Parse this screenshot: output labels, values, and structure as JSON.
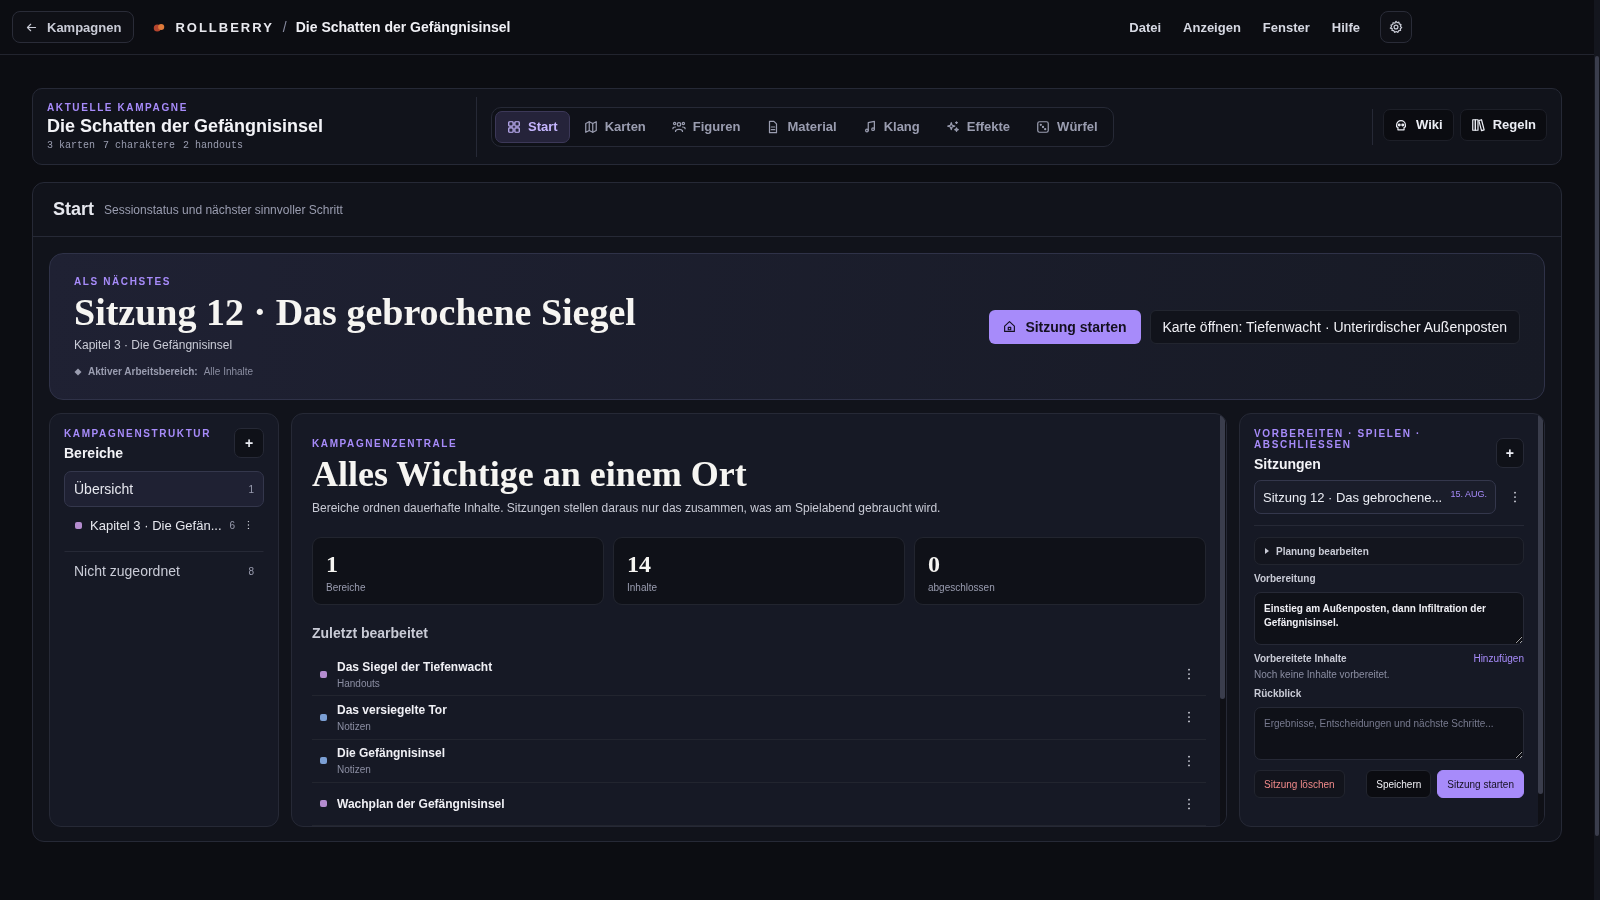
{
  "topbar": {
    "back_button": "Kampagnen",
    "brand": "ROLLBERRY",
    "separator": "/",
    "campaign": "Die Schatten der Gefängnisinsel",
    "menu": [
      "Datei",
      "Anzeigen",
      "Fenster",
      "Hilfe"
    ]
  },
  "campaign_header": {
    "eyebrow": "AKTUELLE KAMPAGNE",
    "title": "Die Schatten der Gefängnisinsel",
    "stats": [
      "3 karten",
      "7 charaktere",
      "2 handouts"
    ],
    "tabs": [
      {
        "label": "Start",
        "selected": true
      },
      {
        "label": "Karten",
        "selected": false
      },
      {
        "label": "Figuren",
        "selected": false
      },
      {
        "label": "Material",
        "selected": false
      },
      {
        "label": "Klang",
        "selected": false
      },
      {
        "label": "Effekte",
        "selected": false
      },
      {
        "label": "Würfel",
        "selected": false
      }
    ],
    "actions": [
      {
        "label": "Wiki"
      },
      {
        "label": "Regeln"
      }
    ]
  },
  "page": {
    "title": "Start",
    "subtitle": "Sessionstatus und nächster sinnvoller Schritt"
  },
  "next_up": {
    "eyebrow": "ALS NÄCHSTES",
    "title": "Sitzung 12 · Das gebrochene Siegel",
    "subtitle": "Kapitel 3 · Die Gefängnisinsel",
    "workspace_label": "Aktiver Arbeitsbereich:",
    "workspace_value": "Alle Inhalte",
    "primary_button": "Sitzung starten",
    "secondary_button": "Karte öffnen: Tiefenwacht · Unterirdischer Außenposten"
  },
  "structure": {
    "eyebrow": "KAMPAGNENSTRUKTUR",
    "title": "Bereiche",
    "add_button": "+",
    "items": [
      {
        "kind": "overview",
        "label": "Übersicht",
        "count": "1",
        "selected": true
      },
      {
        "kind": "area",
        "label": "Kapitel 3 · Die Gefän...",
        "count": "6",
        "color": "#b48ccf",
        "selected": false
      },
      {
        "kind": "unassigned",
        "label": "Nicht zugeordnet",
        "count": "8",
        "selected": false
      }
    ]
  },
  "hub": {
    "eyebrow": "KAMPAGNENZENTRALE",
    "title": "Alles Wichtige an einem Ort",
    "description": "Bereiche ordnen dauerhafte Inhalte. Sitzungen stellen daraus nur das zusammen, was am Spielabend gebraucht wird.",
    "stats": [
      {
        "value": "1",
        "label": "Bereiche"
      },
      {
        "value": "14",
        "label": "Inhalte"
      },
      {
        "value": "0",
        "label": "abgeschlossen"
      }
    ],
    "recent_title": "Zuletzt bearbeitet",
    "recent": [
      {
        "title": "Das Siegel der Tiefenwacht",
        "category": "Handouts",
        "color": "#b48ccf"
      },
      {
        "title": "Das versiegelte Tor",
        "category": "Notizen",
        "color": "#7b9fd4"
      },
      {
        "title": "Die Gefängnisinsel",
        "category": "Notizen",
        "color": "#7b9fd4"
      },
      {
        "title": "Wachplan der Gefängnisinsel",
        "color": "#b48ccf"
      }
    ]
  },
  "sessions": {
    "eyebrow": "VORBEREITEN · SPIELEN · ABSCHLIESSEN",
    "title": "Sitzungen",
    "add_button": "+",
    "list": [
      {
        "title": "Sitzung 12 · Das gebrochene...",
        "date": "15. AUG.",
        "selected": true
      }
    ],
    "planning": {
      "label": "Planung bearbeiten",
      "expanded": false
    },
    "prep_label": "Vorbereitung",
    "prep_value": "Einstieg am Außenposten, dann Infiltration der Gefängnisinsel.",
    "prepared_label": "Vorbereitete Inhalte",
    "add_link": "Hinzufügen",
    "prepared_empty": "Noch keine Inhalte vorbereitet.",
    "review_label": "Rückblick",
    "review_placeholder": "Ergebnisse, Entscheidungen und nächste Schritte...",
    "buttons": [
      {
        "label": "Sitzung löschen",
        "kind": "danger"
      },
      {
        "label": "Speichern",
        "kind": "secondary"
      },
      {
        "label": "Sitzung starten",
        "kind": "primary"
      }
    ]
  }
}
